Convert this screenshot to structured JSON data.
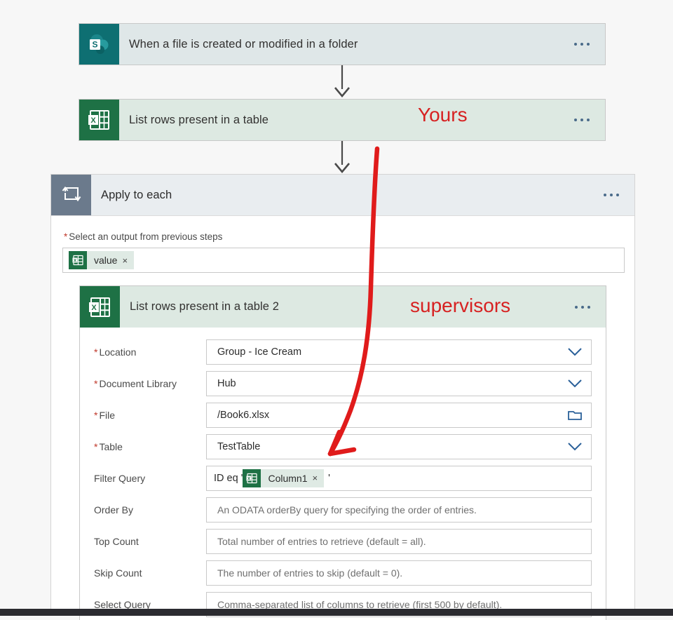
{
  "flow": {
    "trigger": {
      "title": "When a file is created or modified in a folder",
      "icon": "sharepoint-icon",
      "menu": "more-commands"
    },
    "excel_step_1": {
      "title": "List rows present in a table",
      "icon": "excel-icon",
      "menu": "more-commands"
    },
    "apply_to_each": {
      "title": "Apply to each",
      "icon": "loop-icon",
      "menu": "more-commands",
      "output_label": "Select an output from previous steps",
      "output_required": "*",
      "output_token": {
        "label": "value",
        "icon": "excel-icon",
        "remove": "×"
      }
    },
    "excel_step_2": {
      "title": "List rows present in a table 2",
      "icon": "excel-icon",
      "menu": "more-commands"
    },
    "fields": [
      {
        "label": "Location",
        "required": true,
        "value": "Group - Ice Cream",
        "is_placeholder": false,
        "control": "chevron-down-icon"
      },
      {
        "label": "Document Library",
        "required": true,
        "value": "Hub",
        "is_placeholder": false,
        "control": "chevron-down-icon"
      },
      {
        "label": "File",
        "required": true,
        "value": "/Book6.xlsx",
        "is_placeholder": false,
        "control": "folder-icon"
      },
      {
        "label": "Table",
        "required": true,
        "value": "TestTable",
        "is_placeholder": false,
        "control": "chevron-down-icon"
      },
      {
        "label": "Order By",
        "required": false,
        "value": "An ODATA orderBy query for specifying the order of entries.",
        "is_placeholder": true,
        "control": "none"
      },
      {
        "label": "Top Count",
        "required": false,
        "value": "Total number of entries to retrieve (default = all).",
        "is_placeholder": true,
        "control": "none"
      },
      {
        "label": "Skip Count",
        "required": false,
        "value": "The number of entries to skip (default = 0).",
        "is_placeholder": true,
        "control": "none"
      },
      {
        "label": "Select Query",
        "required": false,
        "value": "Comma-separated list of columns to retrieve (first 500 by default).",
        "is_placeholder": true,
        "control": "none"
      }
    ],
    "filter_query": {
      "label": "Filter Query",
      "prefix": "ID eq '",
      "suffix": "'",
      "token": {
        "label": "Column1",
        "icon": "excel-icon",
        "remove": "×"
      }
    }
  },
  "annotations": {
    "yours": "Yours",
    "supervisors": "supervisors",
    "arrow": "hand-drawn-red-arrow"
  },
  "colors": {
    "sharepoint_teal": "#0e6f72",
    "excel_green": "#1e7145",
    "loop_gray": "#6b7a8c",
    "sharepoint_header": "#dfe7e8",
    "excel_header": "#dde9e2",
    "apply_header": "#e9edf0",
    "annotation_red": "#d72222",
    "required_star": "#c0392b",
    "control_blue": "#2a6099",
    "connector_gray": "#4a4a4a"
  }
}
